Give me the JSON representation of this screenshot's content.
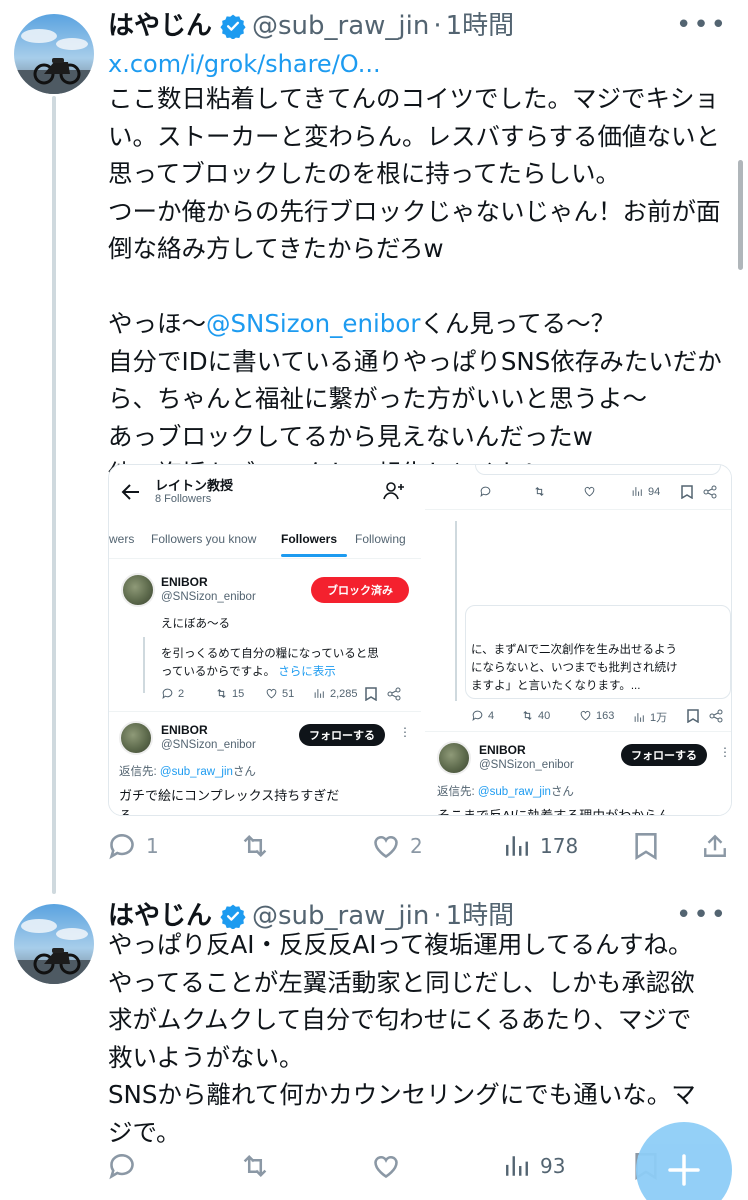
{
  "tweets": [
    {
      "author_name": "はやじん",
      "handle": "@sub_raw_jin",
      "separator": "·",
      "time": "1時間",
      "link": "x.com/i/grok/share/O...",
      "lines": [
        "ここ数日粘着してきてんのコイツでした。マジでキショ",
        "い。ストーカーと変わらん。レスバすらする価値ないと",
        "思ってブロックしたのを根に持ってたらしい。",
        "つーか俺からの先行ブロックじゃないじゃん！お前が面",
        "倒な絡み方してきたからだろw",
        "",
        "",
        "自分でIDに書いている通りやっぱりSNS依存みたいだか",
        "ら、ちゃんと福祉に繋がった方がいいと思うよ〜",
        "あっブロックしてるから見えないんだったw",
        "他の複垢もブロックして報告しとくね！"
      ],
      "mention_line_prefix": "やっほ〜",
      "mention": "@SNSizon_enibor",
      "mention_line_suffix": "くん見ってる〜？",
      "reply_count": "1",
      "retweet_count": "",
      "like_count": "2",
      "view_count": "178"
    },
    {
      "author_name": "はやじん",
      "handle": "@sub_raw_jin",
      "separator": "·",
      "time": "1時間",
      "lines": [
        "やっぱり反AI・反反反AIって複垢運用してるんすね。",
        "やってることが左翼活動家と同じだし、しかも承認欲",
        "求がムクムクして自分で匂わせにくるあたり、マジで",
        "救いようがない。",
        "SNSから離れて何かカウンセリングにでも通いな。マ",
        "ジで。"
      ],
      "reply_count": "",
      "retweet_count": "",
      "like_count": "",
      "view_count": "93"
    }
  ],
  "embed": {
    "left": {
      "profile_title": "レイトン教授",
      "followers_sub": "8 Followers",
      "tabs": [
        "wers",
        "Followers you know",
        "Followers",
        "Following"
      ],
      "user1_name": "ENIBOR",
      "user1_handle": "@SNSizon_enibor",
      "user1_button": "ブロック済み",
      "user1_bio": "えにぼあ〜る",
      "quote_line1": "を引っくるめて自分の糧になっていると思",
      "quote_line2": "っているからですよ。",
      "show_more": "さらに表示",
      "stats": [
        "2",
        "15",
        "51",
        "2,285"
      ],
      "user2_name": "ENIBOR",
      "user2_handle": "@SNSizon_enibor",
      "user2_button": "フォローする",
      "reply_to_prefix": "返信先: ",
      "reply_to_handle": "@sub_raw_jin",
      "reply_to_suffix": "さん",
      "reply_text": "ガチで絵にコンプレックス持ちすぎだ",
      "reply_text_cut": "ろ"
    },
    "right": {
      "top_views": "94",
      "quote_line1": "に、まずAIで二次創作を生み出せるよう",
      "quote_line2": "にならないと、いつまでも批判され続け",
      "quote_line3": "ますよ」と言いたくなります。...",
      "stats": [
        "4",
        "40",
        "163",
        "1万"
      ],
      "user_name": "ENIBOR",
      "user_handle": "@SNSizon_enibor",
      "user_button": "フォローする",
      "reply_to_prefix": "返信先: ",
      "reply_to_handle": "@sub_raw_jin",
      "reply_to_suffix": "さん",
      "reply_text": "そこまで反AIに執着する理由がわからん"
    }
  },
  "colors": {
    "link": "#1d9bf0",
    "verified": "#1d9bf0",
    "blocked_button": "#f4212e",
    "follow_button": "#0f1419",
    "fab": "#8ecdf7"
  }
}
